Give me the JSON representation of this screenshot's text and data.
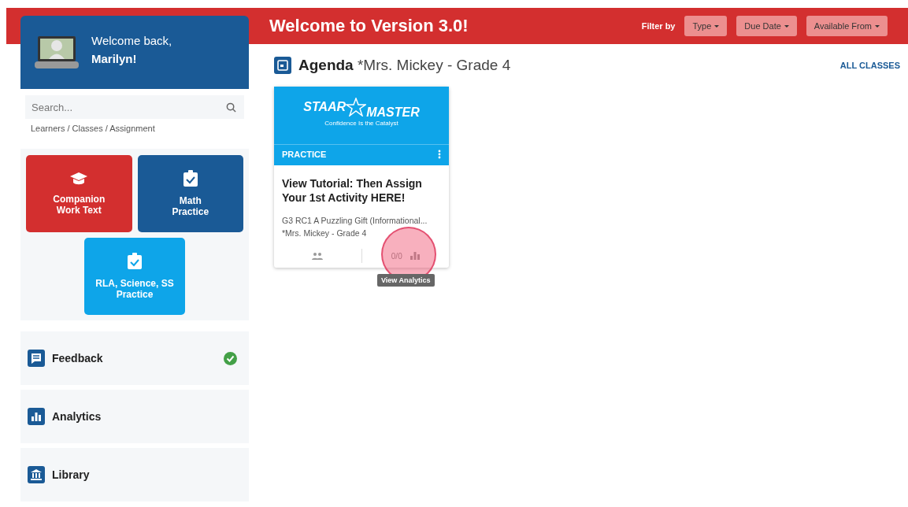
{
  "header": {
    "title": "Welcome to Version 3.0!",
    "filter_label": "Filter by",
    "filters": [
      {
        "label": "Type"
      },
      {
        "label": "Due Date"
      },
      {
        "label": "Available From"
      }
    ]
  },
  "sidebar": {
    "greeting": "Welcome back,",
    "name": "Marilyn!",
    "search": {
      "placeholder": "Search..."
    },
    "breadcrumb": "Learners / Classes / Assignment",
    "tiles": [
      {
        "label": "Companion Work Text",
        "kind": "cap",
        "color": "#d32f2f"
      },
      {
        "label": "Math Practice",
        "kind": "clipboard",
        "color": "#1a5a96"
      },
      {
        "label": "RLA, Science, SS Practice",
        "kind": "clipboard",
        "color": "#0ea5e9"
      }
    ],
    "nav": [
      {
        "label": "Feedback",
        "kind": "feedback",
        "done": true
      },
      {
        "label": "Analytics",
        "kind": "chart",
        "done": false
      },
      {
        "label": "Library",
        "kind": "library",
        "done": false
      }
    ]
  },
  "agenda": {
    "title": "Agenda",
    "class_name": "*Mrs. Mickey - Grade 4",
    "all_classes": "ALL CLASSES",
    "cards": [
      {
        "logo_top": "STAAR",
        "logo_bottom": "MASTER",
        "tagline": "Confidence Is the Catalyst",
        "type": "PRACTICE",
        "title": "View Tutorial: Then Assign Your 1st Activity HERE!",
        "activity": "G3 RC1 A Puzzling Gift (Informational...",
        "class_name": "*Mrs. Mickey - Grade 4",
        "count": "0/0",
        "tooltip": "View Analytics"
      }
    ]
  }
}
